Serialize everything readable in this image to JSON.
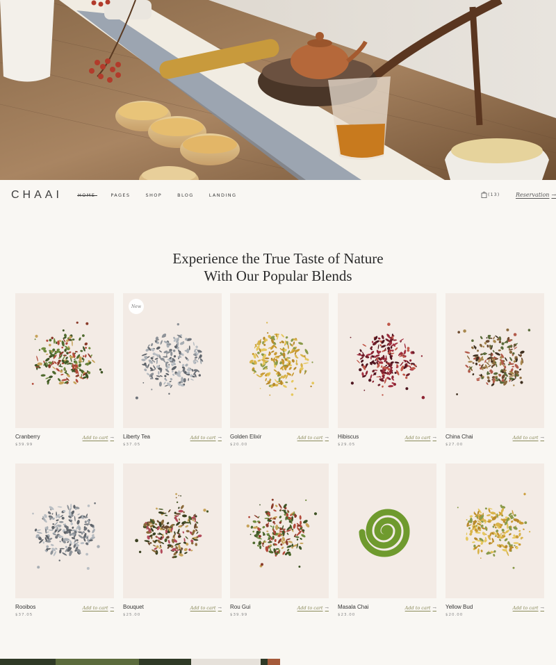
{
  "brand": {
    "logo": "CHAAI"
  },
  "nav": {
    "items": [
      {
        "label": "Home",
        "active": true
      },
      {
        "label": "Pages",
        "active": false
      },
      {
        "label": "Shop",
        "active": false
      },
      {
        "label": "Blog",
        "active": false
      },
      {
        "label": "Landing",
        "active": false
      }
    ],
    "cart_count": "(13)",
    "reservation_label": "Reservation",
    "reservation_arrow": "→"
  },
  "section": {
    "heading_line1": "Experience the True Taste of Nature",
    "heading_line2": "With Our Popular Blends"
  },
  "products": [
    {
      "name": "Cranberry",
      "price": "$39.99",
      "cta": "Add to cart",
      "badge": "",
      "tea": "mixed-red"
    },
    {
      "name": "Liberty Tea",
      "price": "$37.05",
      "cta": "Add to cart",
      "badge": "New",
      "tea": "silver"
    },
    {
      "name": "Golden Elixir",
      "price": "$20.00",
      "cta": "Add to cart",
      "badge": "",
      "tea": "chamomile"
    },
    {
      "name": "Hibiscus",
      "price": "$29.05",
      "cta": "Add to cart",
      "badge": "",
      "tea": "hibiscus"
    },
    {
      "name": "China Chai",
      "price": "$27.00",
      "cta": "Add to cart",
      "badge": "",
      "tea": "chai"
    },
    {
      "name": "Rooibos",
      "price": "$37.05",
      "cta": "Add to cart",
      "badge": "",
      "tea": "silver"
    },
    {
      "name": "Bouquet",
      "price": "$25.00",
      "cta": "Add to cart",
      "badge": "",
      "tea": "bouquet"
    },
    {
      "name": "Rou Gui",
      "price": "$39.99",
      "cta": "Add to cart",
      "badge": "",
      "tea": "mixed-red"
    },
    {
      "name": "Masala Chai",
      "price": "$23.00",
      "cta": "Add to cart",
      "badge": "",
      "tea": "matcha"
    },
    {
      "name": "Yellow Bud",
      "price": "$20.00",
      "cta": "Add to cart",
      "badge": "",
      "tea": "chamomile"
    }
  ],
  "icons": {
    "cart": "shopping-bag-icon",
    "arrow": "arrow-right-icon"
  },
  "colors": {
    "background": "#f9f7f3",
    "card": "#f3ebe5",
    "accent_link": "#8a8a5a"
  }
}
